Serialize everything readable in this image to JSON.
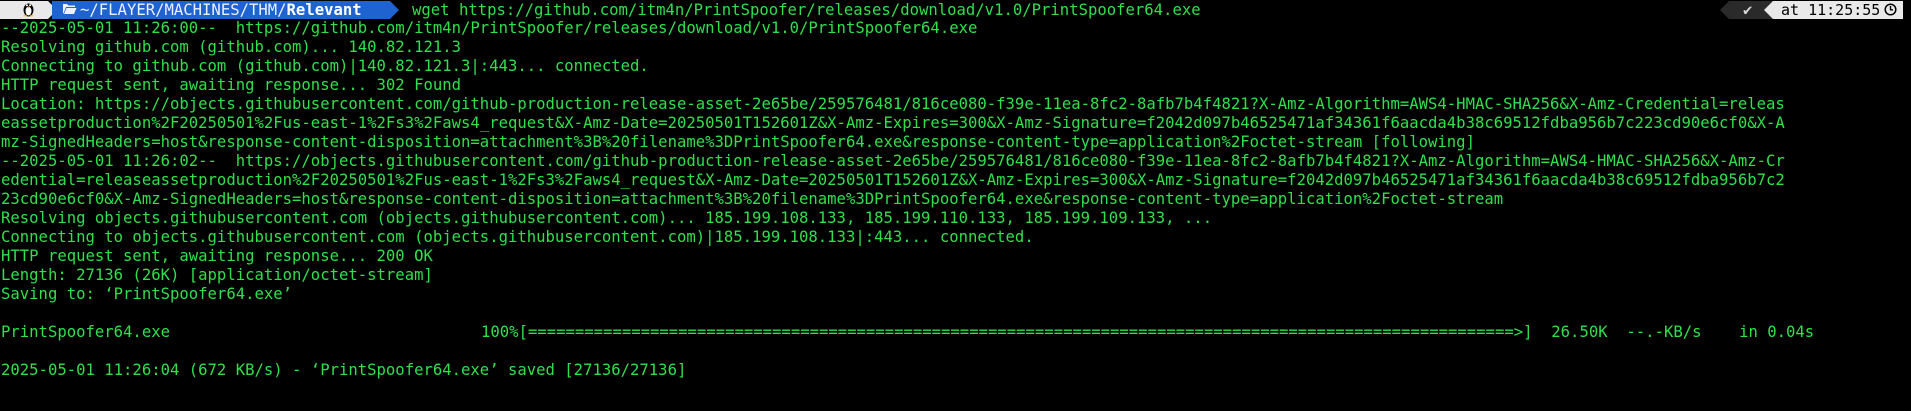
{
  "prompt": {
    "path_prefix": "~/FLAYER/MACHINES/THM/",
    "path_current": "Relevant",
    "command": "wget https://github.com/itm4n/PrintSpoofer/releases/download/v1.0/PrintSpoofer64.exe",
    "status_check": "✔",
    "time": "at 11:25:55",
    "os_icon": "penguin-icon",
    "folder_icon": "folder-open-icon",
    "clock_icon": "clock-icon"
  },
  "output_lines": [
    "--2025-05-01 11:26:00--  https://github.com/itm4n/PrintSpoofer/releases/download/v1.0/PrintSpoofer64.exe",
    "Resolving github.com (github.com)... 140.82.121.3",
    "Connecting to github.com (github.com)|140.82.121.3|:443... connected.",
    "HTTP request sent, awaiting response... 302 Found",
    "Location: https://objects.githubusercontent.com/github-production-release-asset-2e65be/259576481/816ce080-f39e-11ea-8fc2-8afb7b4f4821?X-Amz-Algorithm=AWS4-HMAC-SHA256&X-Amz-Credential=releas",
    "eassetproduction%2F20250501%2Fus-east-1%2Fs3%2Faws4_request&X-Amz-Date=20250501T152601Z&X-Amz-Expires=300&X-Amz-Signature=f2042d097b46525471af34361f6aacda4b38c69512fdba956b7c223cd90e6cf0&X-A",
    "mz-SignedHeaders=host&response-content-disposition=attachment%3B%20filename%3DPrintSpoofer64.exe&response-content-type=application%2Foctet-stream [following]",
    "--2025-05-01 11:26:02--  https://objects.githubusercontent.com/github-production-release-asset-2e65be/259576481/816ce080-f39e-11ea-8fc2-8afb7b4f4821?X-Amz-Algorithm=AWS4-HMAC-SHA256&X-Amz-Cr",
    "edential=releaseassetproduction%2F20250501%2Fus-east-1%2Fs3%2Faws4_request&X-Amz-Date=20250501T152601Z&X-Amz-Expires=300&X-Amz-Signature=f2042d097b46525471af34361f6aacda4b38c69512fdba956b7c2",
    "23cd90e6cf0&X-Amz-SignedHeaders=host&response-content-disposition=attachment%3B%20filename%3DPrintSpoofer64.exe&response-content-type=application%2Foctet-stream",
    "Resolving objects.githubusercontent.com (objects.githubusercontent.com)... 185.199.108.133, 185.199.110.133, 185.199.109.133, ...",
    "Connecting to objects.githubusercontent.com (objects.githubusercontent.com)|185.199.108.133|:443... connected.",
    "HTTP request sent, awaiting response... 200 OK",
    "Length: 27136 (26K) [application/octet-stream]",
    "Saving to: ‘PrintSpoofer64.exe’",
    ""
  ],
  "progress": {
    "filename": "PrintSpoofer64.exe",
    "percent": "100%",
    "bar": "[=========================================================================================================>]",
    "size": "26.50K",
    "rate": "--.-KB/s",
    "eta": "in 0.04s"
  },
  "final_lines": [
    "",
    "2025-05-01 11:26:04 (672 KB/s) - ‘PrintSpoofer64.exe’ saved [27136/27136]"
  ],
  "colors": {
    "terminal_bg": "#000000",
    "text": "#2fe04a",
    "path_segment": "#1e63d0",
    "os_segment": "#e9e9e9",
    "status_segment": "#2a2a2a"
  }
}
